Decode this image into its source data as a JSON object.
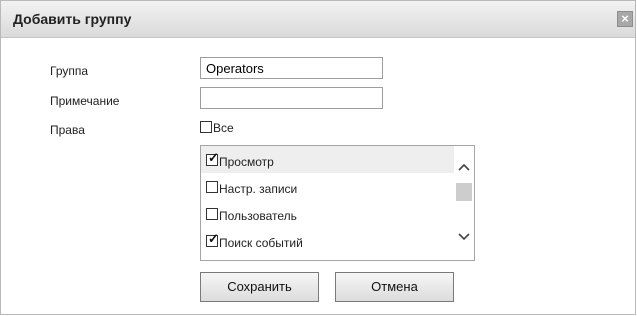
{
  "dialog": {
    "title": "Добавить группу",
    "close_glyph": "×"
  },
  "form": {
    "group_label": "Группа",
    "group_value": "Operators",
    "note_label": "Примечание",
    "note_value": "",
    "rights_label": "Права",
    "all_label": "Все",
    "all_checked": false
  },
  "rights": [
    {
      "label": "Просмотр",
      "checked": true
    },
    {
      "label": "Настр. записи",
      "checked": false
    },
    {
      "label": "Пользователь",
      "checked": false
    },
    {
      "label": "Поиск событий",
      "checked": true
    }
  ],
  "buttons": {
    "save": "Сохранить",
    "cancel": "Отмена"
  },
  "icons": {
    "close": "close-icon",
    "scroll_up": "chevron-up-icon",
    "scroll_down": "chevron-down-icon"
  }
}
